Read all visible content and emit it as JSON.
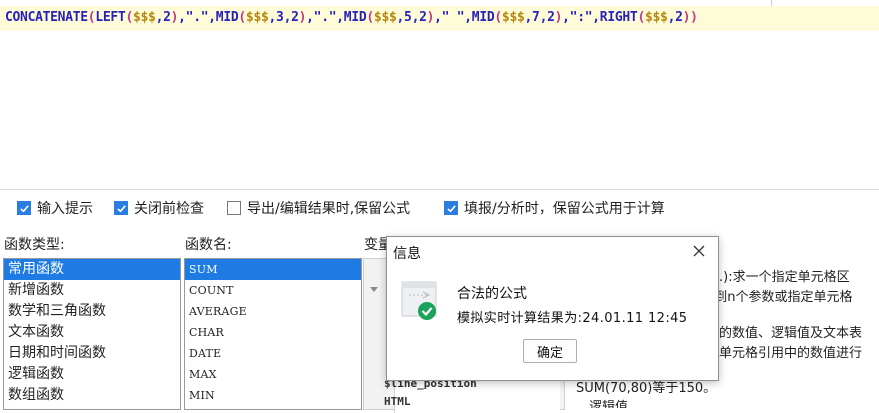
{
  "formula": {
    "tokens": [
      {
        "t": "CONCATENATE",
        "c": "fn"
      },
      {
        "t": "(",
        "c": "p"
      },
      {
        "t": "LEFT",
        "c": "fn"
      },
      {
        "t": "(",
        "c": "p"
      },
      {
        "t": "$$$",
        "c": "ref"
      },
      {
        "t": ",2",
        "c": "plain"
      },
      {
        "t": ")",
        "c": "p"
      },
      {
        "t": ",\".\",",
        "c": "str"
      },
      {
        "t": "MID",
        "c": "fn"
      },
      {
        "t": "(",
        "c": "p"
      },
      {
        "t": "$$$",
        "c": "ref"
      },
      {
        "t": ",3,2",
        "c": "plain"
      },
      {
        "t": ")",
        "c": "p"
      },
      {
        "t": ",\".\",",
        "c": "str"
      },
      {
        "t": "MID",
        "c": "fn"
      },
      {
        "t": "(",
        "c": "p"
      },
      {
        "t": "$$$",
        "c": "ref"
      },
      {
        "t": ",5,2",
        "c": "plain"
      },
      {
        "t": ")",
        "c": "p"
      },
      {
        "t": ",\" \",",
        "c": "str"
      },
      {
        "t": "MID",
        "c": "fn"
      },
      {
        "t": "(",
        "c": "p"
      },
      {
        "t": "$$$",
        "c": "ref"
      },
      {
        "t": ",7,2",
        "c": "plain"
      },
      {
        "t": ")",
        "c": "p"
      },
      {
        "t": ",\":\",",
        "c": "str"
      },
      {
        "t": "RIGHT",
        "c": "fn"
      },
      {
        "t": "(",
        "c": "p"
      },
      {
        "t": "$$$",
        "c": "ref"
      },
      {
        "t": ",2",
        "c": "plain"
      },
      {
        "t": ")",
        "c": "p"
      },
      {
        "t": ")",
        "c": "p"
      }
    ]
  },
  "options": {
    "input_hint": {
      "label": "输入提示",
      "checked": true
    },
    "check_before_close": {
      "label": "关闭前检查",
      "checked": true
    },
    "keep_formula_export": {
      "label": "导出/编辑结果时,保留公式",
      "checked": false
    },
    "keep_formula_calc": {
      "label": "填报/分析时，保留公式用于计算",
      "checked": true
    }
  },
  "labels": {
    "category": "函数类型:",
    "function": "函数名:",
    "variable": "变量"
  },
  "categories": [
    "常用函数",
    "新增函数",
    "数学和三角函数",
    "文本函数",
    "日期和时间函数",
    "逻辑函数",
    "数组函数"
  ],
  "selected_category": "常用函数",
  "functions": [
    "SUM",
    "COUNT",
    "AVERAGE",
    "CHAR",
    "DATE",
    "MAX",
    "MIN"
  ],
  "selected_function": "SUM",
  "variables": [
    "$line_position",
    "HTML"
  ],
  "description": {
    "line1": ",…):求一个指定单元格区",
    "line2": "1到n个参数或指定单元格",
    "line3": "中的数值、逻辑值及文本表",
    "line4": "成单元格引用中的数值进行",
    "line5": "SUM(70,80)等于150。",
    "line6": "                                ，逻辑值"
  },
  "dialog": {
    "title": "信息",
    "message": "合法的公式",
    "result": "模拟实时计算结果为:24.01.11 12:45",
    "ok_label": "确定",
    "accent": "#1aa35a"
  }
}
